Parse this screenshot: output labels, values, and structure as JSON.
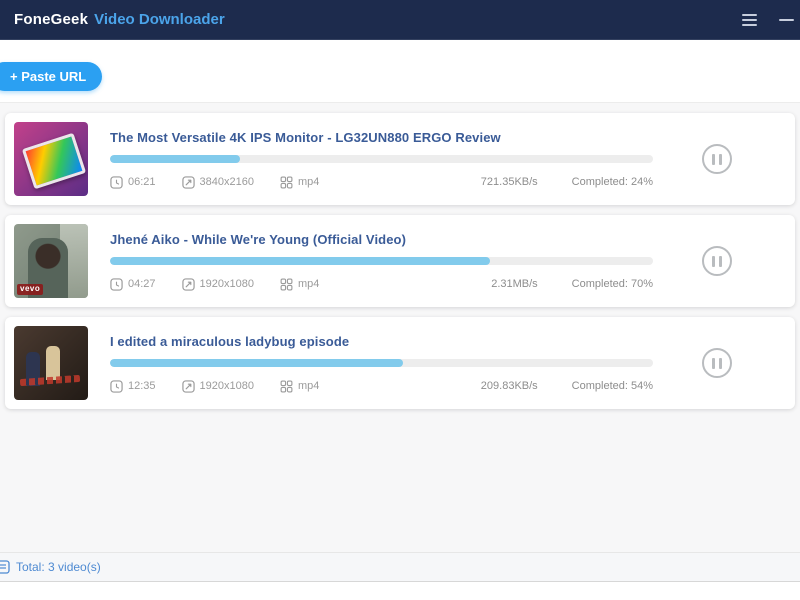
{
  "app": {
    "brand": "FoneGeek",
    "title": "Video Downloader"
  },
  "toolbar": {
    "paste_url_label": "+ Paste URL"
  },
  "downloads": [
    {
      "title": "The Most Versatile 4K IPS Monitor - LG32UN880 ERGO Review",
      "duration": "06:21",
      "resolution": "3840x2160",
      "format": "mp4",
      "speed": "721.35KB/s",
      "completed_label": "Completed: 24%",
      "thumb_kind": "monitor",
      "thumb_colors": [
        "#c2418a",
        "#5b2d86"
      ]
    },
    {
      "title": "Jhené Aiko - While We're Young (Official Video)",
      "duration": "04:27",
      "resolution": "1920x1080",
      "format": "mp4",
      "speed": "2.31MB/s",
      "completed_label": "Completed: 70%",
      "thumb_kind": "vevo",
      "thumb_colors": [
        "#8f9a8c",
        "#6d7a6e"
      ],
      "badge": "vevo"
    },
    {
      "title": "I edited a miraculous ladybug episode",
      "duration": "12:35",
      "resolution": "1920x1080",
      "format": "mp4",
      "speed": "209.83KB/s",
      "completed_label": "Completed: 54%",
      "thumb_kind": "cartoon",
      "thumb_colors": [
        "#4a3a30",
        "#221b16"
      ]
    }
  ],
  "footer": {
    "total_label": "Total: 3 video(s)"
  },
  "colors": {
    "header_bg": "#1d2b4d",
    "accent_blue": "#2ba0f2",
    "brand_blue": "#4ba4ea",
    "title_blue": "#3a5b97",
    "progress_fill": "#82cbec",
    "footer_text": "#4e8ad2"
  }
}
